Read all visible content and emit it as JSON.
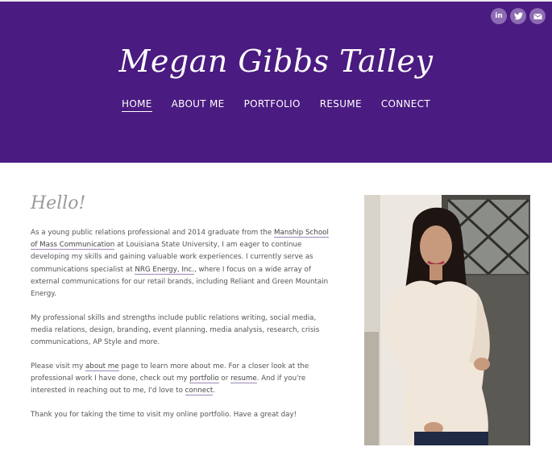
{
  "header": {
    "site_title": "Megan Gibbs Talley",
    "social": [
      {
        "icon": "linkedin-icon",
        "glyph": "in"
      },
      {
        "icon": "twitter-icon",
        "glyph": ""
      },
      {
        "icon": "mail-icon",
        "glyph": ""
      }
    ],
    "nav": [
      {
        "label": "HOME",
        "active": true
      },
      {
        "label": "ABOUT ME",
        "active": false
      },
      {
        "label": "PORTFOLIO",
        "active": false
      },
      {
        "label": "RESUME",
        "active": false
      },
      {
        "label": "CONNECT",
        "active": false
      }
    ]
  },
  "main": {
    "heading": "Hello!",
    "p1": {
      "t1": "As a young public relations professional and 2014 graduate from the ",
      "link1": "Manship School of Mass Communication",
      "t2": " at Louisiana State University, I am eager to continue developing my skills and gaining valuable work experiences. I currently serve as communications specialist at ",
      "link2": "NRG Energy, Inc.",
      "t3": ", where I focus on a wide array of external communications for our retail brands, including Reliant and Green Mountain Energy."
    },
    "p2": "My professional skills and strengths include public relations writing, social media, media relations, design, branding, event planning, media analysis, research, crisis communications, AP Style and more.",
    "p3": {
      "t1": "Please visit my ",
      "link1": "about me",
      "t2": " page to learn more about me. For a closer look at the professional work I have done, check out my ",
      "link2": "portfolio",
      "t3": " or ",
      "link3": "resume",
      "t4": ". And if you're interested in reaching out to me, I'd love to ",
      "link4": "connect",
      "t5": "."
    },
    "p4": "Thank you for taking the time to visit my online portfolio. Have a great day!"
  },
  "colors": {
    "header_bg": "#4a1b80",
    "social_bg": "#8d6bb3",
    "heading": "#9a9a9a",
    "body_text": "#555555",
    "link_underline": "#9b86b8"
  }
}
